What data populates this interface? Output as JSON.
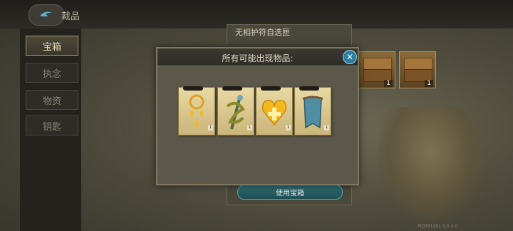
{
  "header": {
    "title": "裁品"
  },
  "sidebar": {
    "tabs": [
      {
        "label": "宝箱",
        "active": true
      },
      {
        "label": "执念",
        "active": false
      },
      {
        "label": "物资",
        "active": false
      },
      {
        "label": "钥匙",
        "active": false
      }
    ]
  },
  "background_panel": {
    "title": "无相护符自选匣",
    "use_button": "使用宝箱"
  },
  "chests": [
    {
      "qty": "1"
    },
    {
      "qty": "1"
    }
  ],
  "dialog": {
    "title": "所有可能出现物品:",
    "close": "✕",
    "items": [
      {
        "icon": "golden-ring-talisman-icon",
        "qty": "1"
      },
      {
        "icon": "vine-staff-talisman-icon",
        "qty": "1"
      },
      {
        "icon": "golden-heart-talisman-icon",
        "qty": "1"
      },
      {
        "icon": "blue-cloth-talisman-icon",
        "qty": "1"
      }
    ]
  },
  "version": "PID331201 1.5.3.0"
}
